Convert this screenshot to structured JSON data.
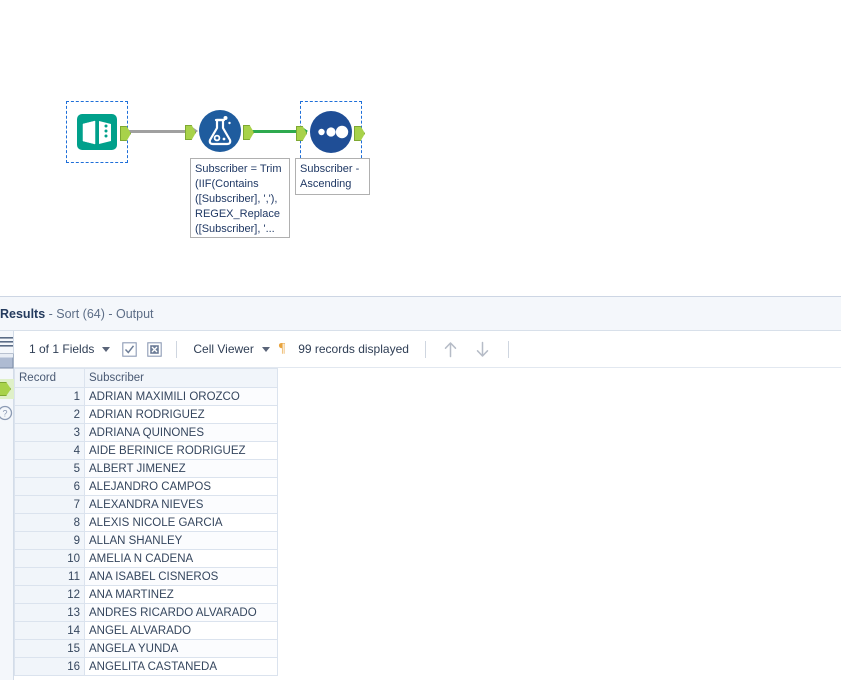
{
  "canvas": {
    "tools": [
      {
        "id": "input-data",
        "name": "Input Data",
        "icon": "book-icon",
        "selected": true,
        "annotation": ""
      },
      {
        "id": "formula",
        "name": "Formula",
        "icon": "flask-icon",
        "selected": false,
        "annotation": "Subscriber = Trim\n(IIF(Contains\n([Subscriber], ','),\nREGEX_Replace\n([Subscriber], '..."
      },
      {
        "id": "sort",
        "name": "Sort",
        "icon": "three-dots-icon",
        "selected": true,
        "annotation": "Subscriber -\nAscending"
      }
    ],
    "connections": [
      {
        "from": "input-data",
        "to": "formula",
        "state": "normal"
      },
      {
        "from": "formula",
        "to": "sort",
        "state": "highlighted"
      }
    ],
    "colors": {
      "input_tool": "#00a08b",
      "formula_tool": "#1f5c9e",
      "sort_tool": "#1f4e96",
      "anchor": "#a8d24a",
      "wire": "#a0a0a0",
      "wire_active": "#2eaa4f",
      "selection": "#1e6fd9"
    }
  },
  "results": {
    "title_label": "Results",
    "title_detail": " - Sort (64) - Output",
    "toolbar": {
      "fields_label": "1 of 1 Fields",
      "select_all_icon": "checkbox-checked-icon",
      "deselect_all_icon": "box-x-icon",
      "viewer_label": "Cell Viewer",
      "pilcrow_icon": "pilcrow-icon",
      "records_label": "99 records displayed",
      "up_icon": "arrow-up-icon",
      "down_icon": "arrow-down-icon"
    },
    "rail_icons": [
      "hamburger-icon",
      "panel-icon",
      "anchor-icon",
      "help-icon"
    ],
    "grid": {
      "columns": [
        "Record",
        "Subscriber"
      ],
      "rows": [
        [
          "1",
          "ADRIAN MAXIMILI OROZCO"
        ],
        [
          "2",
          "ADRIAN RODRIGUEZ"
        ],
        [
          "3",
          "ADRIANA QUINONES"
        ],
        [
          "4",
          "AIDE BERINICE RODRIGUEZ"
        ],
        [
          "5",
          "ALBERT JIMENEZ"
        ],
        [
          "6",
          "ALEJANDRO CAMPOS"
        ],
        [
          "7",
          "ALEXANDRA NIEVES"
        ],
        [
          "8",
          "ALEXIS NICOLE GARCIA"
        ],
        [
          "9",
          "ALLAN SHANLEY"
        ],
        [
          "10",
          "AMELIA N CADENA"
        ],
        [
          "11",
          "ANA ISABEL CISNEROS"
        ],
        [
          "12",
          "ANA MARTINEZ"
        ],
        [
          "13",
          "ANDRES RICARDO ALVARADO"
        ],
        [
          "14",
          "ANGEL ALVARADO"
        ],
        [
          "15",
          "ANGELA YUNDA"
        ],
        [
          "16",
          "ANGELITA CASTANEDA"
        ]
      ]
    }
  }
}
